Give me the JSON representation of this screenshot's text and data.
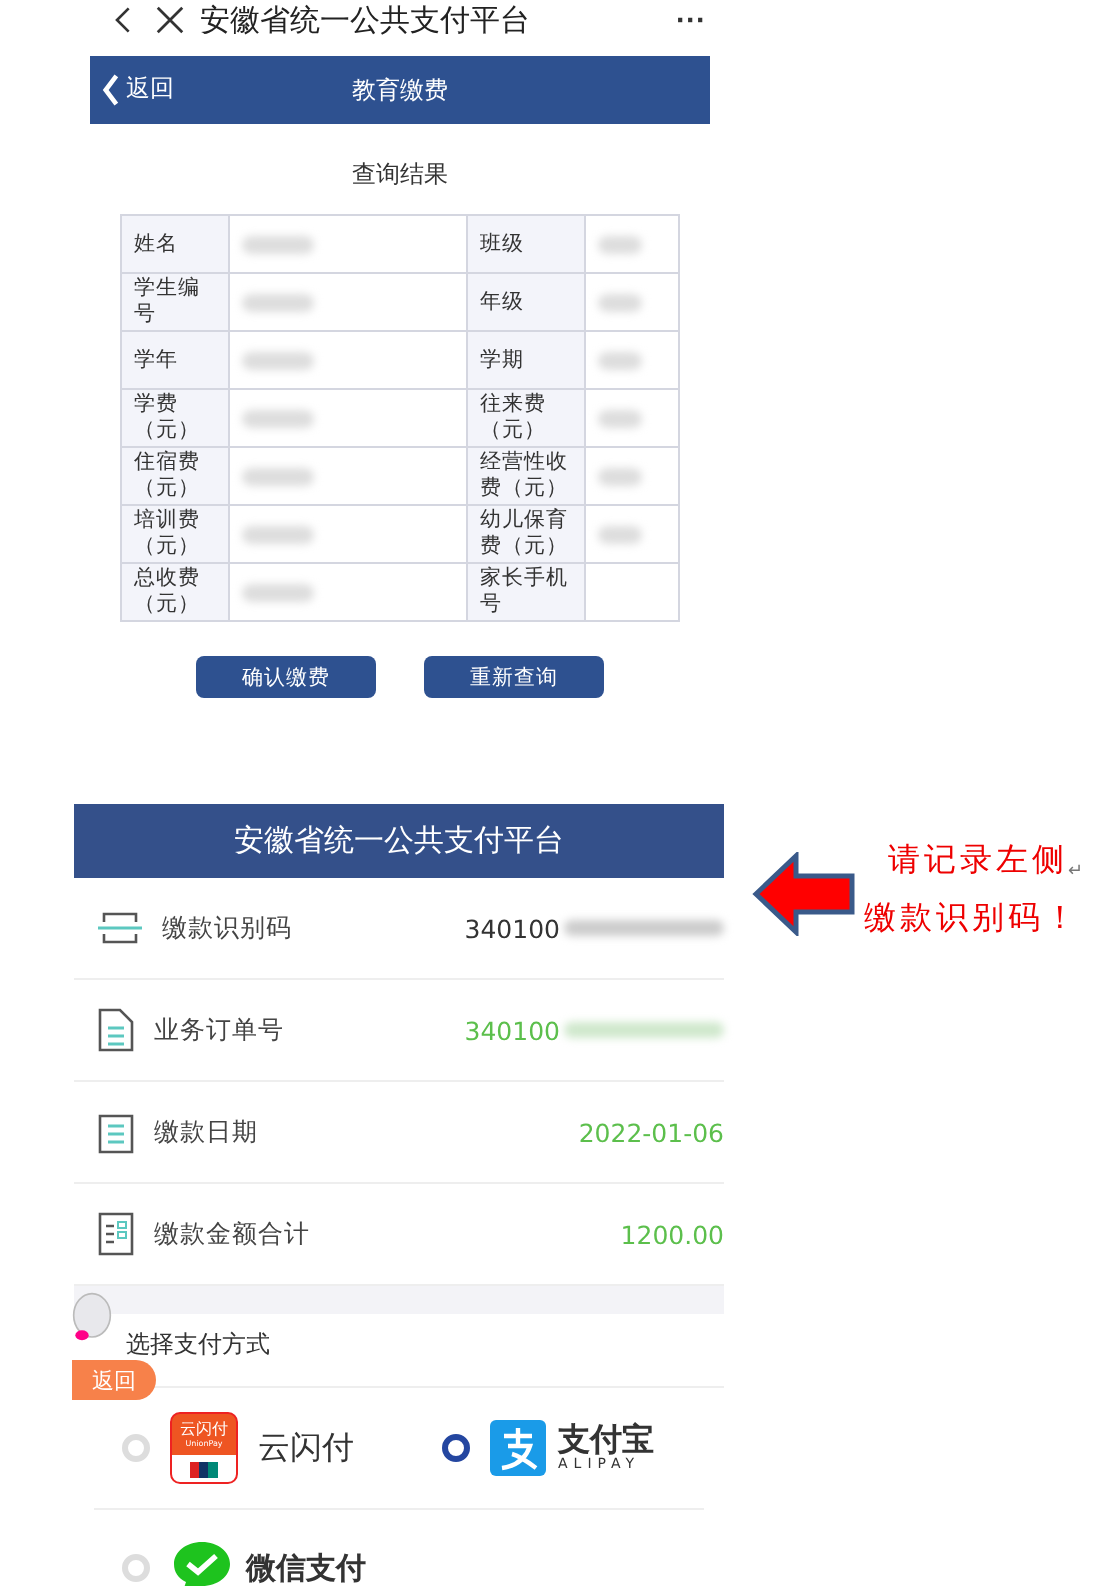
{
  "top_bar": {
    "title": "安徽省统一公共支付平台",
    "more": "···"
  },
  "header": {
    "back": "返回",
    "title": "教育缴费"
  },
  "result_title": "查询结果",
  "table": {
    "rows": [
      {
        "cells": [
          {
            "label": "姓名",
            "blurred": true
          },
          {
            "label": "班级",
            "blurred": true
          }
        ]
      },
      {
        "cells": [
          {
            "label": "学生编号",
            "blurred": true
          },
          {
            "label": "年级",
            "blurred": true
          }
        ]
      },
      {
        "cells": [
          {
            "label": "学年",
            "blurred": true
          },
          {
            "label": "学期",
            "blurred": true
          }
        ]
      },
      {
        "cells": [
          {
            "label": "学费（元）",
            "blurred": true
          },
          {
            "label": "往来费（元）",
            "blurred": true
          }
        ]
      },
      {
        "cells": [
          {
            "label": "住宿费（元）",
            "blurred": true
          },
          {
            "label": "经营性收费（元）",
            "blurred": true
          }
        ]
      },
      {
        "cells": [
          {
            "label": "培训费（元）",
            "blurred": true
          },
          {
            "label": "幼儿保育费（元）",
            "blurred": true
          }
        ]
      },
      {
        "cells": [
          {
            "label": "总收费（元）",
            "blurred": true
          },
          {
            "label": "家长手机号"
          }
        ]
      }
    ]
  },
  "buttons": [
    "确认缴费",
    "重新查询"
  ],
  "payment": {
    "title": "安徽省统一公共支付平台",
    "rows": [
      {
        "kind": "scan",
        "label": "缴款识别码",
        "value": "340100",
        "blurred": true,
        "highlight": false
      },
      {
        "kind": "document",
        "label": "业务订单号",
        "value": "340100",
        "blurred": true,
        "highlight": true
      },
      {
        "kind": "calendar",
        "label": "缴款日期",
        "value": "2022-01-06",
        "highlight": true
      },
      {
        "kind": "ledger",
        "label": "缴款金额合计",
        "value": "1200.00",
        "highlight": true
      }
    ]
  },
  "pay_methods": {
    "title": "选择支付方式",
    "options": [
      {
        "kind": "unionpay",
        "label": "云闪付",
        "logo_text": "云闪付",
        "logo_sub": "UnionPay",
        "selected": false
      },
      {
        "kind": "alipay",
        "label": "支付宝",
        "logo_sub": "ALIPAY",
        "selected": true
      },
      {
        "kind": "wechat",
        "label": "微信支付",
        "selected": false
      }
    ]
  },
  "float_back": "返回",
  "annotation": {
    "lines": [
      "请记录左侧",
      "缴款识别码！"
    ],
    "mark": "↵"
  }
}
